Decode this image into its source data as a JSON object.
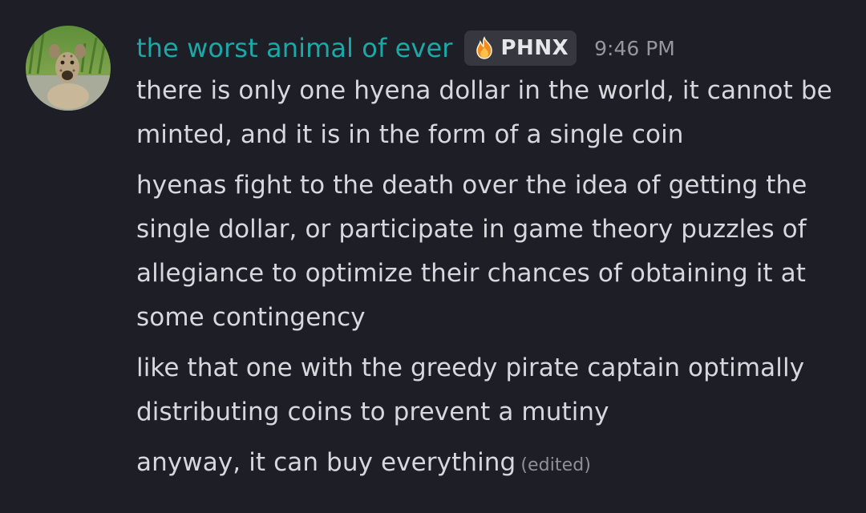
{
  "author": {
    "username": "the worst animal of ever",
    "avatar_icon": "hyena-avatar",
    "username_color": "#1aa8a8"
  },
  "clan_tag": {
    "icon": "flame-badge-icon",
    "name": "PHNX"
  },
  "timestamp": "9:46 PM",
  "messages": [
    {
      "text": "there is only one hyena dollar in the world, it cannot be minted, and it is in the form of a single coin"
    },
    {
      "text": "hyenas fight to the death over the idea of getting the single dollar, or participate in game theory puzzles of allegiance to optimize their chances of obtaining it at some contingency"
    },
    {
      "text": "like that one with the greedy pirate captain optimally distributing coins to prevent a mutiny"
    },
    {
      "text": "anyway, it can buy everything",
      "edited_label": "(edited)"
    }
  ],
  "colors": {
    "background": "#1e1e26",
    "text": "#d7d8dd",
    "muted": "#95969f",
    "tag_bg": "#373740"
  }
}
